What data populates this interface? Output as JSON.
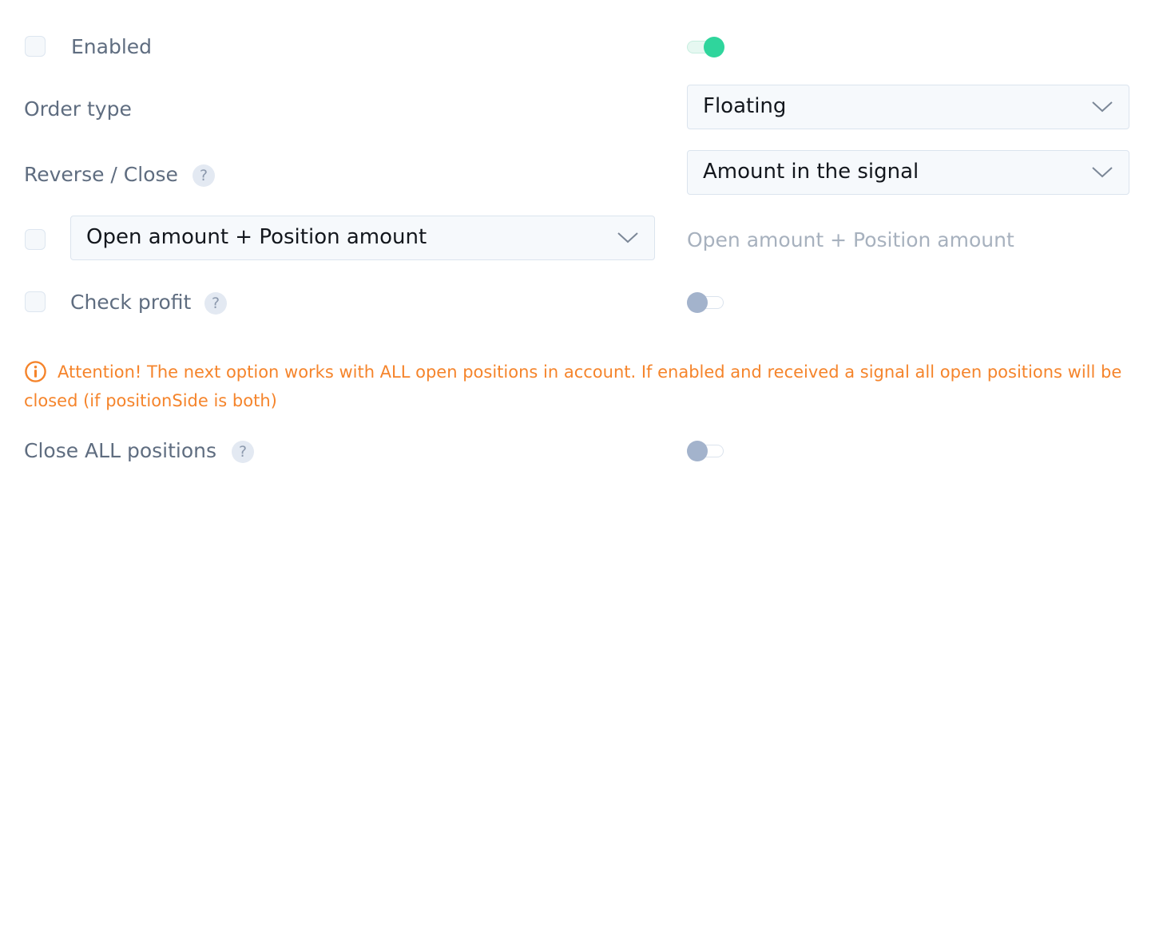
{
  "settings": {
    "enabled": {
      "label": "Enabled",
      "checked": false,
      "toggle_on": true
    },
    "order_type": {
      "label": "Order type",
      "value": "Floating"
    },
    "reverse_close": {
      "label": "Reverse / Close",
      "help": "?",
      "value": "Amount in the signal"
    },
    "amount_mode": {
      "checked": false,
      "value": "Open amount + Position amount",
      "preview": "Open amount + Position amount"
    },
    "check_profit": {
      "label": "Check profit",
      "help": "?",
      "checked": false,
      "toggle_on": false
    },
    "attention": {
      "text": "Attention! The next option works with ALL open positions in account. If enabled and received a signal all open positions will be closed (if positionSide is both)"
    },
    "close_all": {
      "label": "Close ALL positions",
      "help": "?",
      "toggle_on": false
    }
  },
  "colors": {
    "label": "#5f6d80",
    "accent_green": "#2fd59c",
    "warning": "#f5842b",
    "toggle_off_knob": "#a3b3cc"
  },
  "icons": [
    "chevron-down-icon",
    "info-circle-icon",
    "question-icon"
  ]
}
